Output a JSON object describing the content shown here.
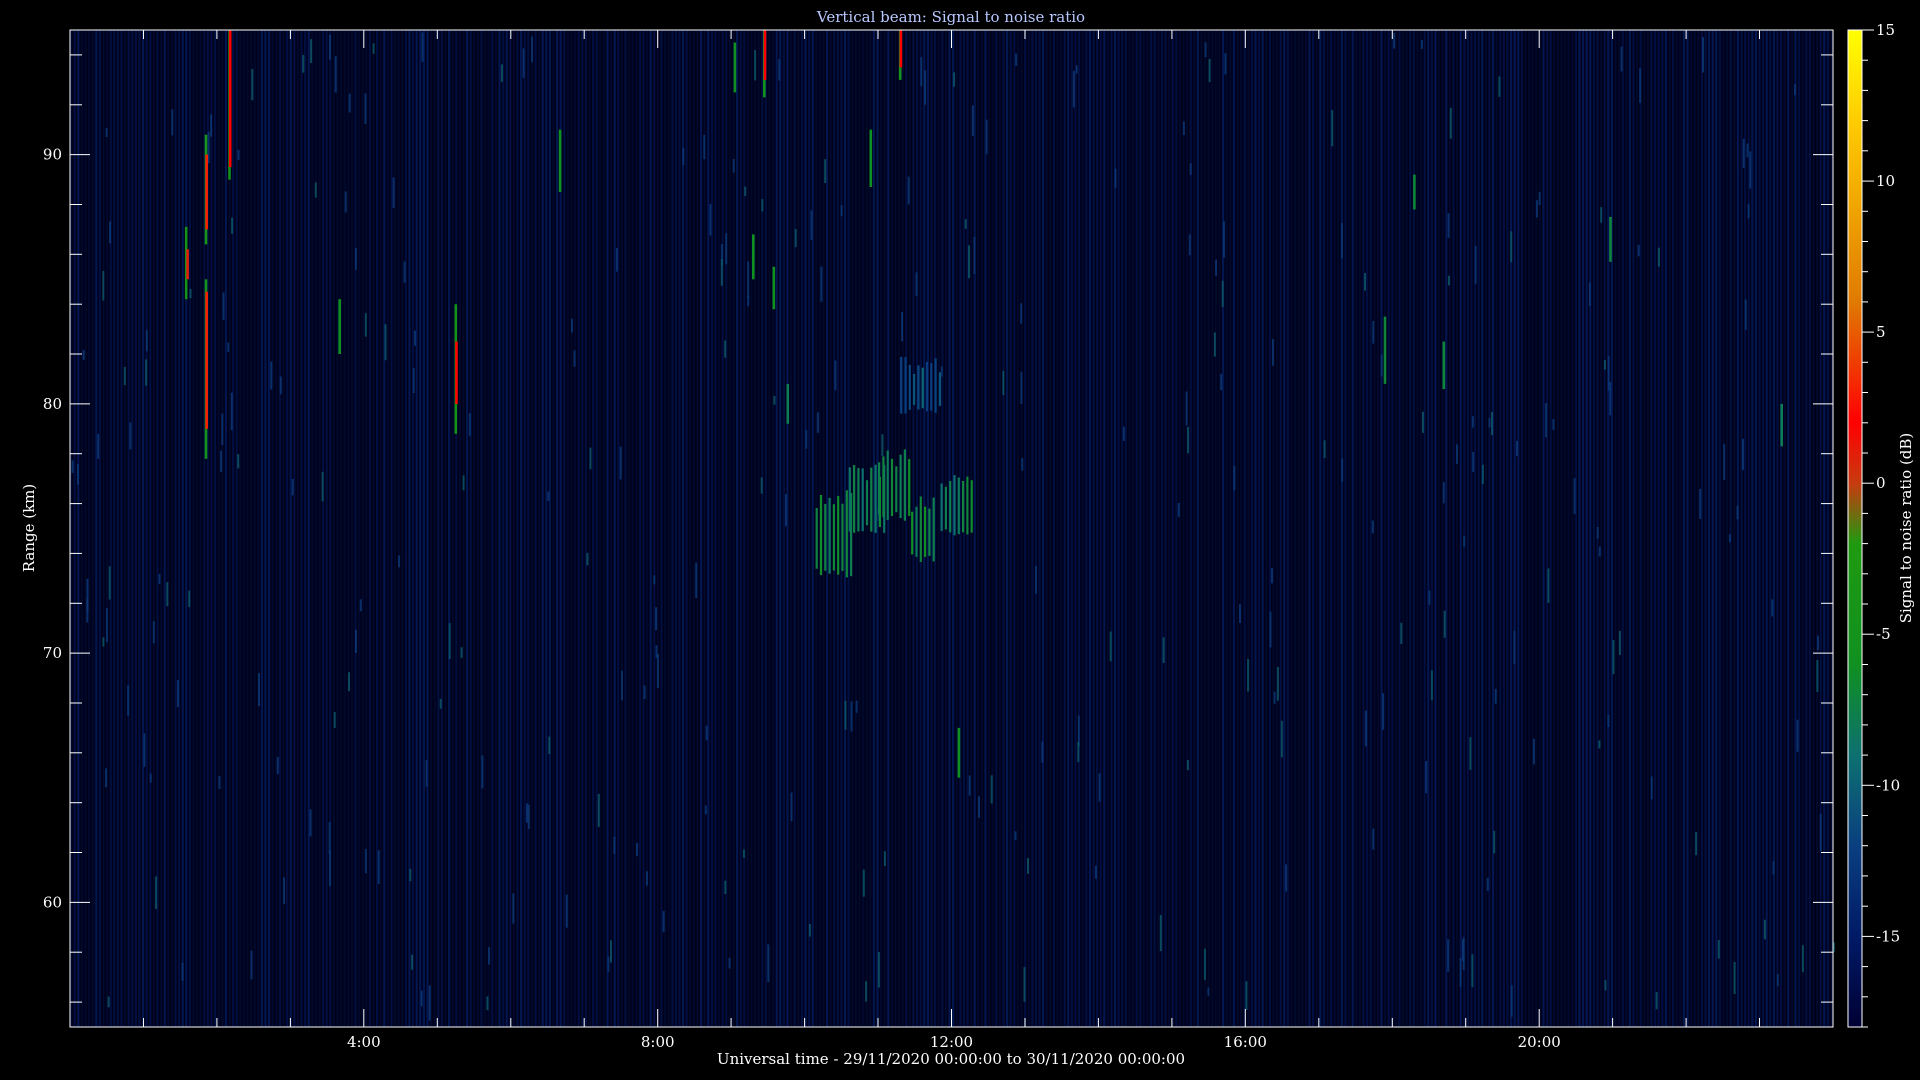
{
  "chart_data": {
    "type": "heatmap",
    "title": "Vertical beam: Signal to noise ratio",
    "xlabel": "Universal time - 29/11/2020 00:00:00 to 30/11/2020 00:00:00",
    "ylabel": "Range (km)",
    "xlim": [
      0,
      24
    ],
    "ylim": [
      55,
      95
    ],
    "x_ticks": [
      {
        "value": 4,
        "label": "4:00"
      },
      {
        "value": 8,
        "label": "8:00"
      },
      {
        "value": 12,
        "label": "12:00"
      },
      {
        "value": 16,
        "label": "16:00"
      },
      {
        "value": 20,
        "label": "20:00"
      }
    ],
    "y_ticks": [
      {
        "value": 60,
        "label": "60"
      },
      {
        "value": 70,
        "label": "70"
      },
      {
        "value": 80,
        "label": "80"
      },
      {
        "value": 90,
        "label": "90"
      }
    ],
    "colorbar": {
      "label": "Signal to noise ratio (dB)",
      "range": [
        -18,
        15
      ],
      "ticks": [
        {
          "value": 15,
          "label": "15"
        },
        {
          "value": 10,
          "label": "10"
        },
        {
          "value": 5,
          "label": "5"
        },
        {
          "value": 0,
          "label": "0"
        },
        {
          "value": -5,
          "label": "-5"
        },
        {
          "value": -10,
          "label": "-10"
        },
        {
          "value": -15,
          "label": "-15"
        }
      ],
      "colors": [
        {
          "value": -18,
          "color": "#000033"
        },
        {
          "value": -15,
          "color": "#001a66"
        },
        {
          "value": -12,
          "color": "#0a3f80"
        },
        {
          "value": -9,
          "color": "#0d7070"
        },
        {
          "value": -6,
          "color": "#109020"
        },
        {
          "value": -2,
          "color": "#1f9a10"
        },
        {
          "value": 0,
          "color": "#c83a10"
        },
        {
          "value": 2,
          "color": "#ff0000"
        },
        {
          "value": 6,
          "color": "#e07a00"
        },
        {
          "value": 12,
          "color": "#ffcc00"
        },
        {
          "value": 15,
          "color": "#ffff00"
        }
      ]
    },
    "echoes": [
      {
        "t": 1.58,
        "r0": 84.2,
        "r1": 87.1,
        "snr": -5
      },
      {
        "t": 1.6,
        "r0": 85.0,
        "r1": 86.2,
        "snr": 1
      },
      {
        "t": 1.85,
        "r0": 86.4,
        "r1": 90.8,
        "snr": -4
      },
      {
        "t": 1.86,
        "r0": 87.0,
        "r1": 90.0,
        "snr": 3
      },
      {
        "t": 1.85,
        "r0": 77.8,
        "r1": 85.0,
        "snr": -5
      },
      {
        "t": 1.86,
        "r0": 79.0,
        "r1": 84.5,
        "snr": 3
      },
      {
        "t": 2.17,
        "r0": 89.0,
        "r1": 95.0,
        "snr": -5
      },
      {
        "t": 2.18,
        "r0": 89.5,
        "r1": 95.0,
        "snr": 2
      },
      {
        "t": 3.67,
        "r0": 82.0,
        "r1": 84.2,
        "snr": -6
      },
      {
        "t": 5.25,
        "r0": 78.8,
        "r1": 84.0,
        "snr": -5
      },
      {
        "t": 5.26,
        "r0": 80.0,
        "r1": 82.5,
        "snr": 2
      },
      {
        "t": 6.67,
        "r0": 88.5,
        "r1": 91.0,
        "snr": -6
      },
      {
        "t": 9.05,
        "r0": 92.5,
        "r1": 94.5,
        "snr": -6
      },
      {
        "t": 9.3,
        "r0": 85.0,
        "r1": 86.8,
        "snr": -6
      },
      {
        "t": 9.45,
        "r0": 92.3,
        "r1": 95.0,
        "snr": -5
      },
      {
        "t": 9.46,
        "r0": 93.0,
        "r1": 95.0,
        "snr": 2
      },
      {
        "t": 9.58,
        "r0": 83.8,
        "r1": 85.5,
        "snr": -6
      },
      {
        "t": 9.77,
        "r0": 79.2,
        "r1": 80.8,
        "snr": -8
      },
      {
        "t": 10.9,
        "r0": 88.7,
        "r1": 91.0,
        "snr": -6
      },
      {
        "t": 11.3,
        "r0": 93.0,
        "r1": 95.0,
        "snr": -5
      },
      {
        "t": 11.31,
        "r0": 93.5,
        "r1": 95.0,
        "snr": 2
      },
      {
        "t": 12.1,
        "r0": 65.0,
        "r1": 67.0,
        "snr": -6
      },
      {
        "t": 17.9,
        "r0": 80.8,
        "r1": 83.5,
        "snr": -7
      },
      {
        "t": 18.3,
        "r0": 87.8,
        "r1": 89.2,
        "snr": -7
      },
      {
        "t": 18.7,
        "r0": 80.6,
        "r1": 82.5,
        "snr": -7
      },
      {
        "t": 20.97,
        "r0": 85.7,
        "r1": 87.5,
        "snr": -7
      },
      {
        "t": 23.3,
        "r0": 78.3,
        "r1": 80.0,
        "snr": -8
      }
    ],
    "echo_clusters": [
      {
        "t": [
          10.15,
          10.65
        ],
        "r": [
          73.2,
          76.2
        ],
        "snr": -7
      },
      {
        "t": [
          10.6,
          11.1
        ],
        "r": [
          75.0,
          77.2
        ],
        "snr": -8
      },
      {
        "t": [
          11.0,
          11.45
        ],
        "r": [
          75.5,
          77.8
        ],
        "snr": -7
      },
      {
        "t": [
          11.45,
          11.8
        ],
        "r": [
          73.8,
          76.0
        ],
        "snr": -7
      },
      {
        "t": [
          11.85,
          12.3
        ],
        "r": [
          74.8,
          77.0
        ],
        "snr": -8
      },
      {
        "t": [
          11.3,
          11.85
        ],
        "r": [
          79.8,
          81.5
        ],
        "snr": -11
      }
    ]
  }
}
